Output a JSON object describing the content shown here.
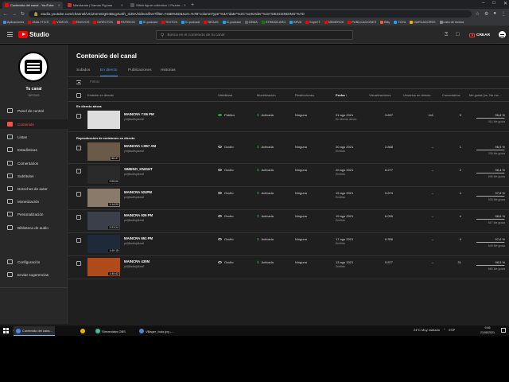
{
  "browser": {
    "tabs": [
      {
        "title": "Contenido del canal - YouTube",
        "color": "#ff0000",
        "active": true
      },
      {
        "title": "Mandarala | Damas Figuras",
        "color": "#d32f2f",
        "active": false
      },
      {
        "title": "Stitch figure collection 1 Puzzle...",
        "color": "#555555",
        "active": false
      }
    ],
    "new_tab": "+",
    "url": "studio.youtube.com/channel/UCiZvmnDgO4Bcg4UZh_3iJ5A/videos/live?filter=%5B%5D&sort=%7B\"columnType\"%3A\"date\"%2C\"sortOrder\"%3A\"DESCENDING\"%7D",
    "bookmarks": [
      {
        "label": "Aplicaciones",
        "color": "#4a90e2"
      },
      {
        "label": "ANALYTICS",
        "color": "#ff0000"
      },
      {
        "label": "VIDEOS",
        "color": "#ff0000"
      },
      {
        "label": "ENVIVOS",
        "color": "#ff0000"
      },
      {
        "label": "DIRECTOS",
        "color": "#ff0000"
      },
      {
        "label": "PATREON",
        "color": "#ff424d"
      },
      {
        "label": "IC.podcast",
        "color": "#1da1f2"
      },
      {
        "label": "TEXTOS",
        "color": "#ff0000"
      },
      {
        "label": "IC.podcast",
        "color": "#1da1f2"
      },
      {
        "label": "NEGAS",
        "color": "#ff0000"
      },
      {
        "label": "IC.podcast",
        "color": "#1da1f2"
      },
      {
        "label": "GEMA",
        "color": "#666666"
      },
      {
        "label": "STREAM-ARG",
        "color": "#0b7d0b"
      },
      {
        "label": "BRVA",
        "color": "#1da1f2"
      },
      {
        "label": "Super!T",
        "color": "#ff0000"
      },
      {
        "label": "MEMEROS",
        "color": "#ff0000"
      },
      {
        "label": "PUBLICACIONES",
        "color": "#ff0000"
      },
      {
        "label": "Bitly",
        "color": "#ee6123"
      },
      {
        "label": "TOYA",
        "color": "#1da1f2"
      },
      {
        "label": "MARCADORES",
        "color": "#f9ab00"
      },
      {
        "label": "Lista de lectura",
        "color": "#888888"
      }
    ]
  },
  "studio": {
    "logo_text": "Studio",
    "search_placeholder": "Busca en el contenido de tu canal",
    "create_label": "CREAR"
  },
  "channel": {
    "title": "Tu canal",
    "name": "NEGAS"
  },
  "nav": {
    "items": [
      {
        "label": "Panel de control",
        "icon": "dashboard-icon",
        "active": false
      },
      {
        "label": "Contenido",
        "icon": "content-icon",
        "active": true
      },
      {
        "label": "Listas",
        "icon": "playlist-icon",
        "active": false
      },
      {
        "label": "Estadísticas",
        "icon": "analytics-icon",
        "active": false
      },
      {
        "label": "Comentarios",
        "icon": "comments-icon",
        "active": false
      },
      {
        "label": "Subtítulos",
        "icon": "subtitles-icon",
        "active": false
      },
      {
        "label": "Derechos de autor",
        "icon": "copyright-icon",
        "active": false
      },
      {
        "label": "Monetización",
        "icon": "monetization-icon",
        "active": false
      },
      {
        "label": "Personalización",
        "icon": "customization-icon",
        "active": false
      },
      {
        "label": "Biblioteca de audio",
        "icon": "audio-library-icon",
        "active": false
      }
    ],
    "bottom": [
      {
        "label": "Configuración",
        "icon": "settings-icon"
      },
      {
        "label": "Enviar sugerencias",
        "icon": "feedback-icon"
      }
    ]
  },
  "content": {
    "page_title": "Contenido del canal",
    "tabs": [
      "Subidos",
      "En directo",
      "Publicaciones",
      "Historias"
    ],
    "active_tab": 1,
    "filter_placeholder": "Filtrar",
    "columns": {
      "stream": "Emisión en directo",
      "visibility": "Visibilidad",
      "monetization": "Monetización",
      "restrictions": "Restricciones",
      "date": "Fecha",
      "views": "Visualizaciones",
      "live_users": "Usuarios en directo",
      "comments": "Comentarios",
      "likes": "Me gusta (vs. No me..."
    },
    "section_live": "En directo ahora",
    "section_past": "Reproducción de emisiones en directo",
    "live_rows": [
      {
        "title": "MAINCRA 7:06 PM",
        "desc": "pkfjfksdfsjdkesfl",
        "visibility": "Público",
        "visibility_public": true,
        "monetization": "Activada",
        "restrictions": "Ninguna",
        "date": "21 ago 2021",
        "date_sub": "En directo ahora",
        "views": "3.897",
        "live_users": "141",
        "comments": "0",
        "likes": "96,8 %",
        "likes_pct": 0.968,
        "likes_sub": "414 Me gusta",
        "thumb_bg": "#dddddd",
        "duration": ""
      }
    ],
    "past_rows": [
      {
        "title": "MAINCRA 1:857 AM",
        "desc": "pkfjfksdfsjdkesfl",
        "visibility": "Oculto",
        "visibility_public": false,
        "monetization": "Activada",
        "restrictions": "Ninguna",
        "date": "20 ago 2021",
        "date_sub": "Emitido",
        "views": "2.868",
        "live_users": "–",
        "comments": "1",
        "likes": "98,5 %",
        "likes_pct": 0.985,
        "likes_sub": "230 Me gusta",
        "thumb_bg": "#6b5a48",
        "duration": "56:47"
      },
      {
        "title": "SIMENO_KNIGHT",
        "desc": "pkfjfksdfsjdkesfl",
        "visibility": "Oculto",
        "visibility_public": false,
        "monetization": "Activada",
        "restrictions": "Ninguna",
        "date": "20 ago 2021",
        "date_sub": "Emitido",
        "views": "8.277",
        "live_users": "–",
        "comments": "2",
        "likes": "98,4 %",
        "likes_pct": 0.984,
        "likes_sub": "608 Me gusta",
        "thumb_bg": "#2a2a2a",
        "duration": "2:55:00"
      },
      {
        "title": "MAINCRA 524PM",
        "desc": "pkfjfksdfsjdkesfl",
        "visibility": "Oculto",
        "visibility_public": false,
        "monetization": "Activada",
        "restrictions": "Ninguna",
        "date": "19 ago 2021",
        "date_sub": "Emitido",
        "views": "5.873",
        "live_users": "–",
        "comments": "4",
        "likes": "97,8 %",
        "likes_pct": 0.978,
        "likes_sub": "533 Me gusta",
        "thumb_bg": "#8a7a6a",
        "duration": "1:14:20"
      },
      {
        "title": "MAINCRA 926 PM",
        "desc": "pkfjfksdfsjdkesfl",
        "visibility": "Oculto",
        "visibility_public": false,
        "monetization": "Activada",
        "restrictions": "Ninguna",
        "date": "19 ago 2021",
        "date_sub": "Emitido",
        "views": "6.099",
        "live_users": "–",
        "comments": "4",
        "likes": "98,6 %",
        "likes_pct": 0.986,
        "likes_sub": "517 Me gusta",
        "thumb_bg": "#3a3f4a",
        "duration": "2:23:24"
      },
      {
        "title": "MAINCRA 851 PM",
        "desc": "pkfjfksdfsjdkesfl",
        "visibility": "Oculto",
        "visibility_public": false,
        "monetization": "Activada",
        "restrictions": "Ninguna",
        "date": "17 ago 2021",
        "date_sub": "Emitido",
        "views": "6.356",
        "live_users": "–",
        "comments": "0",
        "likes": "97,6 %",
        "likes_pct": 0.976,
        "likes_sub": "649 Me gusta",
        "thumb_bg": "#1e2a3a",
        "duration": "1:40:15"
      },
      {
        "title": "MAINCRA 430M",
        "desc": "pkfjfksdfsjdkesfl",
        "visibility": "Oculto",
        "visibility_public": false,
        "monetization": "Activada",
        "restrictions": "Ninguna",
        "date": "13 ago 2021",
        "date_sub": "Emitido",
        "views": "5.877",
        "live_users": "–",
        "comments": "31",
        "likes": "98,5 %",
        "likes_pct": 0.985,
        "likes_sub": "680 Me gusta",
        "thumb_bg": "#b04a1a",
        "duration": "1:40:42"
      }
    ]
  },
  "taskbar": {
    "apps": [
      {
        "label": "Contenido del cana...",
        "color": "#4285f4",
        "active": true
      },
      {
        "label": "",
        "color": "#f0b400",
        "active": false
      },
      {
        "label": "Streamlabs OBS",
        "color": "#31c3a2",
        "active": false
      },
      {
        "label": "Villager_todo.jpg -...",
        "color": "#4a8ad4",
        "active": false
      }
    ],
    "weather": "24°C  Muy nublado",
    "language": "ESP",
    "time": "9:46",
    "date": "21/08/2021"
  }
}
